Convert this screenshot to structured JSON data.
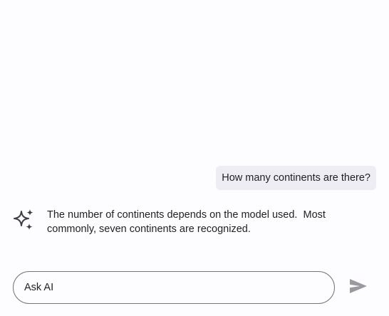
{
  "conversation": {
    "user_message": "How many continents are there?",
    "ai_message": "The number of continents depends on the model used.  Most commonly, seven continents are recognized."
  },
  "composer": {
    "placeholder": "Ask AI",
    "send_icon": "send-icon"
  },
  "icons": {
    "assistant": "sparkle-icon"
  },
  "colors": {
    "user_bubble": "#eeedf3",
    "icon": "#3e3d44",
    "send_icon": "#9a999f",
    "input_border": "#75747c"
  }
}
